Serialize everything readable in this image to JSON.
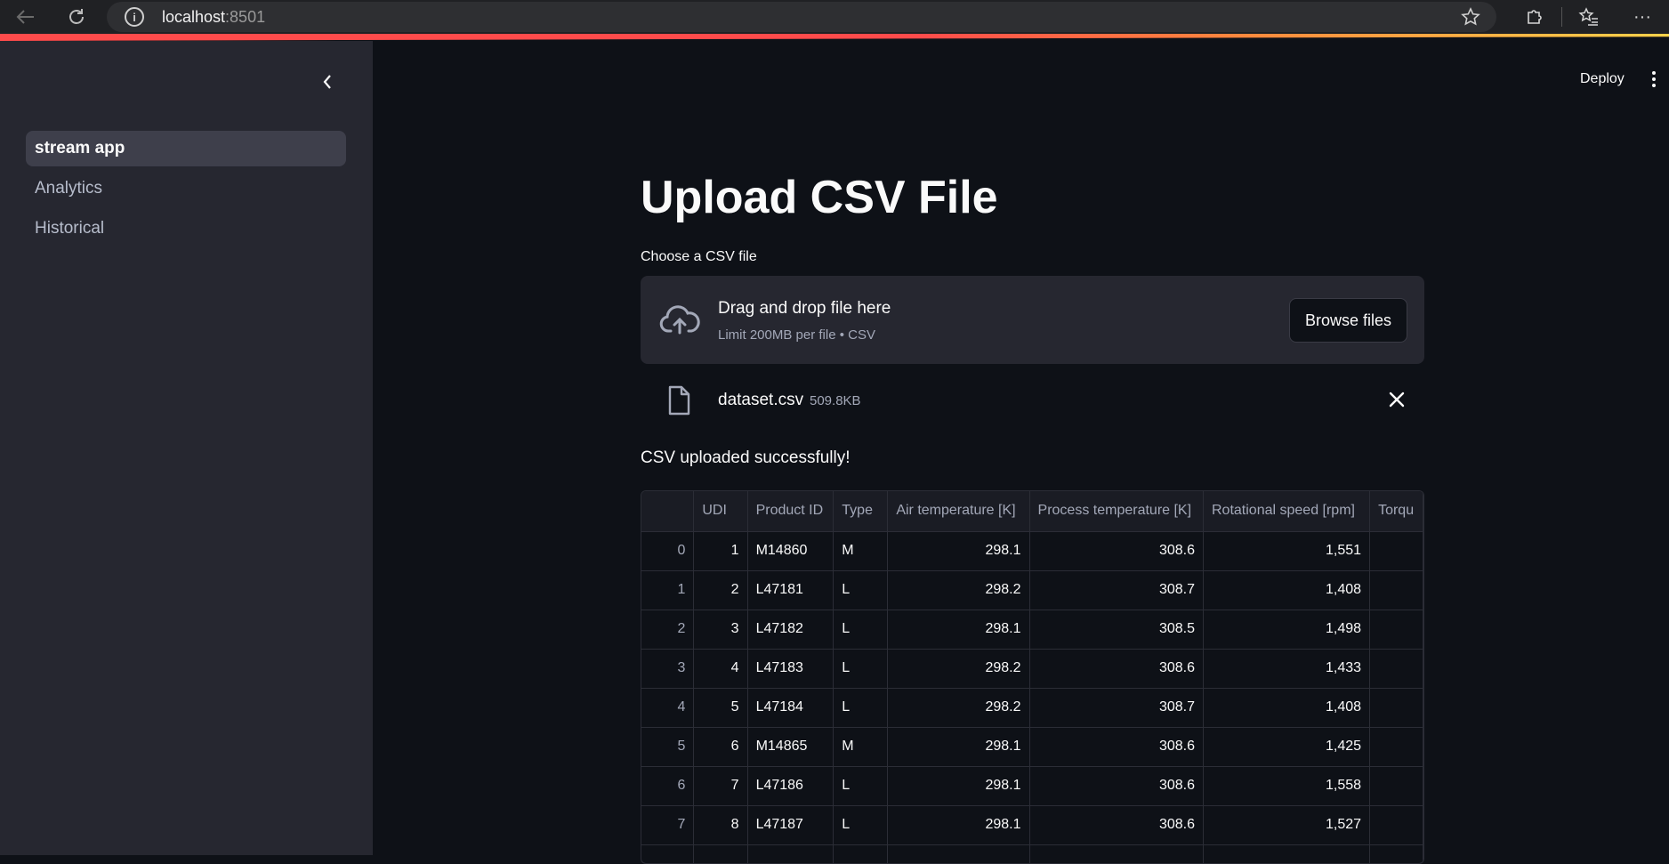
{
  "browser": {
    "host": "localhost",
    "port": ":8501"
  },
  "sidebar": {
    "items": [
      {
        "label": "stream app",
        "active": true
      },
      {
        "label": "Analytics",
        "active": false
      },
      {
        "label": "Historical",
        "active": false
      }
    ]
  },
  "header": {
    "deploy_label": "Deploy"
  },
  "main": {
    "title": "Upload CSV File",
    "uploader": {
      "label": "Choose a CSV file",
      "drop_title": "Drag and drop file here",
      "drop_subtitle": "Limit 200MB per file • CSV",
      "browse_label": "Browse files"
    },
    "file": {
      "name": "dataset.csv",
      "size": "509.8KB"
    },
    "success_message": "CSV uploaded successfully!",
    "table": {
      "columns": [
        "",
        "UDI",
        "Product ID",
        "Type",
        "Air temperature [K]",
        "Process temperature [K]",
        "Rotational speed [rpm]",
        "Torqu"
      ],
      "rows": [
        [
          "0",
          "1",
          "M14860",
          "M",
          "298.1",
          "308.6",
          "1,551",
          ""
        ],
        [
          "1",
          "2",
          "L47181",
          "L",
          "298.2",
          "308.7",
          "1,408",
          ""
        ],
        [
          "2",
          "3",
          "L47182",
          "L",
          "298.1",
          "308.5",
          "1,498",
          ""
        ],
        [
          "3",
          "4",
          "L47183",
          "L",
          "298.2",
          "308.6",
          "1,433",
          ""
        ],
        [
          "4",
          "5",
          "L47184",
          "L",
          "298.2",
          "308.7",
          "1,408",
          ""
        ],
        [
          "5",
          "6",
          "M14865",
          "M",
          "298.1",
          "308.6",
          "1,425",
          ""
        ],
        [
          "6",
          "7",
          "L47186",
          "L",
          "298.1",
          "308.6",
          "1,558",
          ""
        ],
        [
          "7",
          "8",
          "L47187",
          "L",
          "298.1",
          "308.6",
          "1,527",
          ""
        ],
        [
          "",
          "",
          "",
          "",
          "",
          "",
          "",
          ""
        ]
      ]
    }
  },
  "colors": {
    "background": "#0e1117",
    "sidebar": "#262730",
    "accent": "#ff4b4b"
  }
}
